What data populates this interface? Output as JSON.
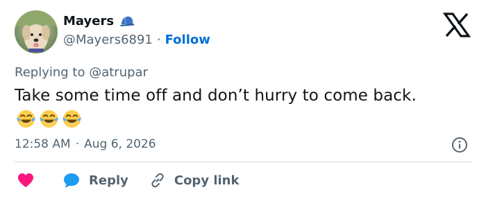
{
  "author": {
    "name": "Mayers",
    "handle": "@Mayers6891",
    "separator": "·",
    "follow_label": "Follow"
  },
  "platform_icon": "x-logo-icon",
  "reply_to": {
    "prefix": "Replying to",
    "mention": "@atrupar"
  },
  "tweet": {
    "text": "Take some time off and don’t hurry to come back.",
    "emojis": [
      "face-with-tears-of-joy",
      "face-with-tears-of-joy",
      "face-with-tears-of-joy"
    ]
  },
  "meta": {
    "time": "12:58 AM",
    "separator": "·",
    "date": "Aug 6, 2026"
  },
  "actions": {
    "reply_label": "Reply",
    "copy_link_label": "Copy link"
  },
  "colors": {
    "accent": "#006fd6",
    "secondary_text": "#536471",
    "heart": "#f91880",
    "reply_bubble": "#1d9bf0",
    "divider": "#cfd9de"
  }
}
